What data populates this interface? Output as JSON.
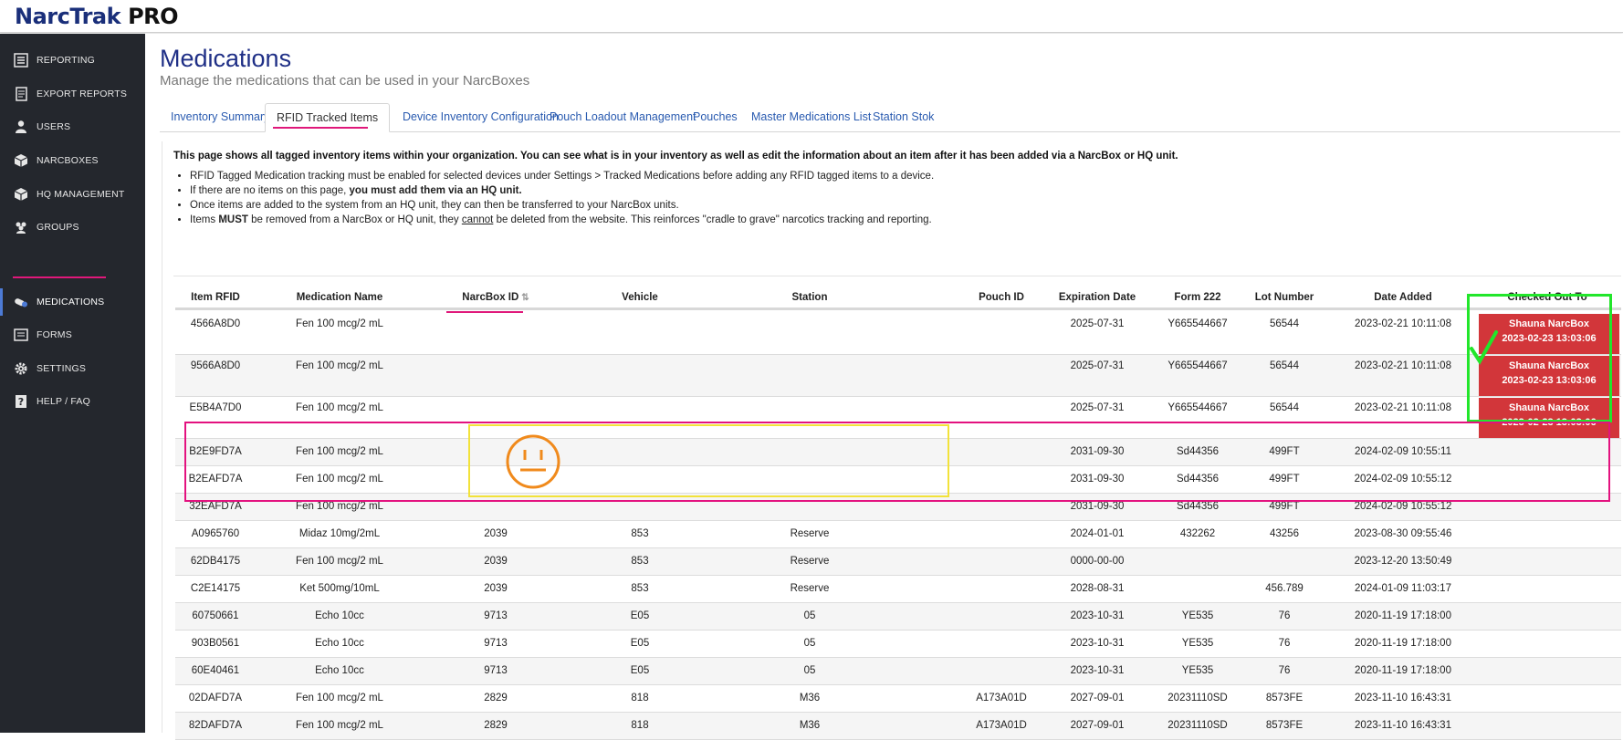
{
  "app": {
    "logo_narc": "Narc",
    "logo_trak": "Trak",
    "logo_pro": "PRO"
  },
  "sidebar": {
    "items": [
      {
        "label": "REPORTING",
        "icon": "list-icon"
      },
      {
        "label": "EXPORT REPORTS",
        "icon": "document-icon"
      },
      {
        "label": "USERS",
        "icon": "user-icon"
      },
      {
        "label": "NARCBOXES",
        "icon": "box-icon"
      },
      {
        "label": "HQ MANAGEMENT",
        "icon": "cube-icon"
      },
      {
        "label": "GROUPS",
        "icon": "group-icon"
      },
      {
        "label": "MEDICATIONS",
        "icon": "pill-icon"
      },
      {
        "label": "FORMS",
        "icon": "form-icon"
      },
      {
        "label": "SETTINGS",
        "icon": "gear-icon"
      },
      {
        "label": "HELP / FAQ",
        "icon": "help-icon"
      }
    ],
    "active": "MEDICATIONS"
  },
  "page": {
    "title": "Medications",
    "subtitle": "Manage the medications that can be used in your NarcBoxes"
  },
  "tabs": [
    "Inventory Summary",
    "RFID Tracked Items",
    "Device Inventory Configuration",
    "Pouch Loadout Management",
    "Pouches",
    "Master Medications List",
    "Station Stok"
  ],
  "active_tab": "RFID Tracked Items",
  "intro": "This page shows all tagged inventory items within your organization. You can see what is in your inventory as well as edit the information about an item after it has been added via a NarcBox or HQ unit.",
  "bullets": {
    "b1": "RFID Tagged Medication tracking must be enabled for selected devices under Settings > Tracked Medications before adding any RFID tagged items to a device.",
    "b2_pre": "If there are no items on this page, ",
    "b2_bold": "you must add them via an HQ unit.",
    "b3": "Once items are added to the system from an HQ unit, they can then be transferred to your NarcBox units.",
    "b4_pre": "Items ",
    "b4_bold": "MUST",
    "b4_mid": " be removed from a NarcBox or HQ unit, they ",
    "b4_u": "cannot",
    "b4_post": " be deleted from the website. This reinforces \"cradle to grave\" narcotics tracking and reporting."
  },
  "table": {
    "headers": [
      "Item RFID",
      "Medication Name",
      "NarcBox ID",
      "Vehicle",
      "Station",
      "Pouch ID",
      "Expiration Date",
      "Form 222",
      "Lot Number",
      "Date Added",
      "Checked Out To"
    ],
    "rows": [
      {
        "rfid": "4566A8D0",
        "med": "Fen 100 mcg/2 mL",
        "narcbox": "",
        "vehicle": "",
        "station": "",
        "pouch": "",
        "exp": "2025-07-31",
        "form": "Y665544667",
        "lot": "56544",
        "added": "2023-02-21 10:11:08",
        "checked_name": "Shauna NarcBox",
        "checked_date": "2023-02-23 13:03:06"
      },
      {
        "rfid": "9566A8D0",
        "med": "Fen 100 mcg/2 mL",
        "narcbox": "",
        "vehicle": "",
        "station": "",
        "pouch": "",
        "exp": "2025-07-31",
        "form": "Y665544667",
        "lot": "56544",
        "added": "2023-02-21 10:11:08",
        "checked_name": "Shauna NarcBox",
        "checked_date": "2023-02-23 13:03:06"
      },
      {
        "rfid": "E5B4A7D0",
        "med": "Fen 100 mcg/2 mL",
        "narcbox": "",
        "vehicle": "",
        "station": "",
        "pouch": "",
        "exp": "2025-07-31",
        "form": "Y665544667",
        "lot": "56544",
        "added": "2023-02-21 10:11:08",
        "checked_name": "Shauna NarcBox",
        "checked_date": "2023-02-23 13:03:06"
      },
      {
        "rfid": "B2E9FD7A",
        "med": "Fen 100 mcg/2 mL",
        "narcbox": "",
        "vehicle": "",
        "station": "",
        "pouch": "",
        "exp": "2031-09-30",
        "form": "Sd44356",
        "lot": "499FT",
        "added": "2024-02-09 10:55:11"
      },
      {
        "rfid": "B2EAFD7A",
        "med": "Fen 100 mcg/2 mL",
        "narcbox": "",
        "vehicle": "",
        "station": "",
        "pouch": "",
        "exp": "2031-09-30",
        "form": "Sd44356",
        "lot": "499FT",
        "added": "2024-02-09 10:55:12"
      },
      {
        "rfid": "32EAFD7A",
        "med": "Fen 100 mcg/2 mL",
        "narcbox": "",
        "vehicle": "",
        "station": "",
        "pouch": "",
        "exp": "2031-09-30",
        "form": "Sd44356",
        "lot": "499FT",
        "added": "2024-02-09 10:55:12"
      },
      {
        "rfid": "A0965760",
        "med": "Midaz 10mg/2mL",
        "narcbox": "2039",
        "vehicle": "853",
        "station": "Reserve",
        "pouch": "",
        "exp": "2024-01-01",
        "form": "432262",
        "lot": "43256",
        "added": "2023-08-30 09:55:46"
      },
      {
        "rfid": "62DB4175",
        "med": "Fen 100 mcg/2 mL",
        "narcbox": "2039",
        "vehicle": "853",
        "station": "Reserve",
        "pouch": "",
        "exp": "0000-00-00",
        "form": "",
        "lot": "",
        "added": "2023-12-20 13:50:49"
      },
      {
        "rfid": "C2E14175",
        "med": "Ket 500mg/10mL",
        "narcbox": "2039",
        "vehicle": "853",
        "station": "Reserve",
        "pouch": "",
        "exp": "2028-08-31",
        "form": "",
        "lot": "456.789",
        "added": "2024-01-09 11:03:17"
      },
      {
        "rfid": "60750661",
        "med": "Echo 10cc",
        "narcbox": "9713",
        "vehicle": "E05",
        "station": "05",
        "pouch": "",
        "exp": "2023-10-31",
        "form": "YE535",
        "lot": "76",
        "added": "2020-11-19 17:18:00"
      },
      {
        "rfid": "903B0561",
        "med": "Echo 10cc",
        "narcbox": "9713",
        "vehicle": "E05",
        "station": "05",
        "pouch": "",
        "exp": "2023-10-31",
        "form": "YE535",
        "lot": "76",
        "added": "2020-11-19 17:18:00"
      },
      {
        "rfid": "60E40461",
        "med": "Echo 10cc",
        "narcbox": "9713",
        "vehicle": "E05",
        "station": "05",
        "pouch": "",
        "exp": "2023-10-31",
        "form": "YE535",
        "lot": "76",
        "added": "2020-11-19 17:18:00"
      },
      {
        "rfid": "02DAFD7A",
        "med": "Fen 100 mcg/2 mL",
        "narcbox": "2829",
        "vehicle": "818",
        "station": "M36",
        "pouch": "A173A01D",
        "exp": "2027-09-01",
        "form": "20231110SD",
        "lot": "8573FE",
        "added": "2023-11-10 16:43:31"
      },
      {
        "rfid": "82DAFD7A",
        "med": "Fen 100 mcg/2 mL",
        "narcbox": "2829",
        "vehicle": "818",
        "station": "M36",
        "pouch": "A173A01D",
        "exp": "2027-09-01",
        "form": "20231110SD",
        "lot": "8573FE",
        "added": "2023-11-10 16:43:31"
      }
    ]
  },
  "colors": {
    "accent": "#1f2f86",
    "link": "#2a5bb0",
    "checked_out": "#d2363a",
    "annotation_green": "#22e62b",
    "annotation_pink": "#e3127f",
    "annotation_yellow": "#f2e23a",
    "annotation_orange": "#f08a1c"
  }
}
